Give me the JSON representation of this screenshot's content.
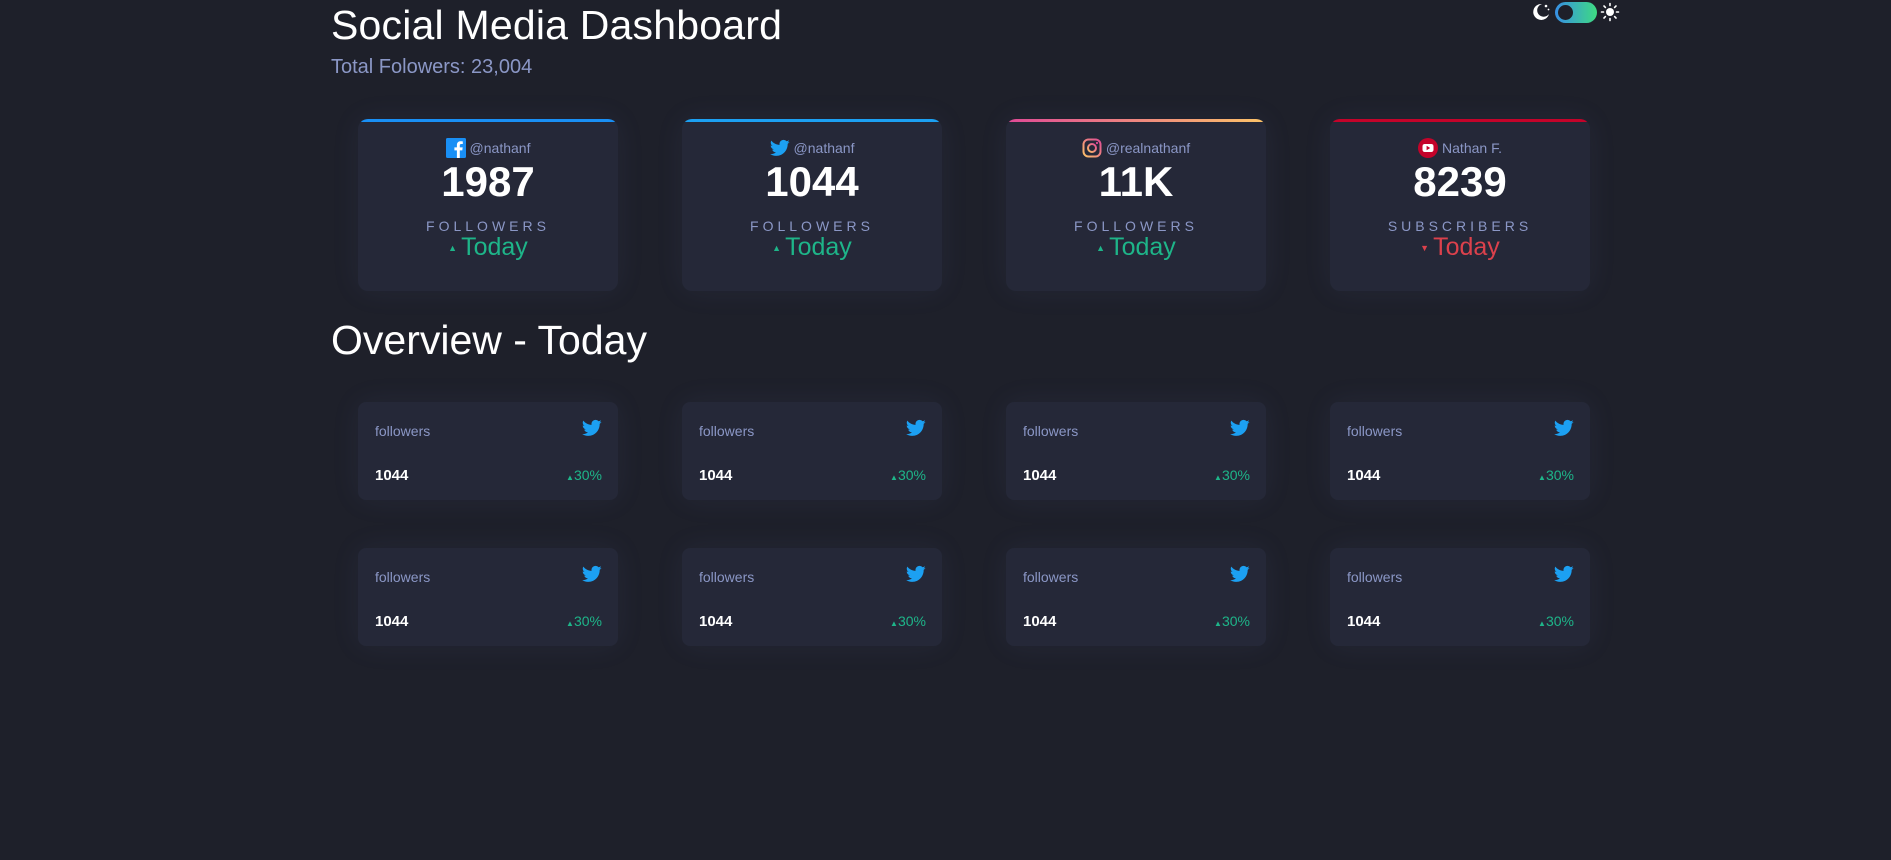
{
  "header": {
    "title": "Social Media Dashboard",
    "subtitle": "Total Folowers: 23,004"
  },
  "theme_toggle": {
    "mode": "dark",
    "moon_icon": "moon-icon",
    "sun_icon": "sun-icon"
  },
  "colors": {
    "background": "#1e202a",
    "card": "#252838",
    "text_muted": "#8b97c6",
    "up": "#1eb589",
    "down": "#dc414c",
    "facebook": "#198ff5",
    "twitter": "#1ca0f2",
    "youtube": "#c4032a"
  },
  "cards": [
    {
      "platform": "facebook",
      "icon": "facebook-icon",
      "handle": "@nathanf",
      "count": "1987",
      "label": "FOLLOWERS",
      "change": "Today",
      "trend": "up"
    },
    {
      "platform": "twitter",
      "icon": "twitter-icon",
      "handle": "@nathanf",
      "count": "1044",
      "label": "FOLLOWERS",
      "change": "Today",
      "trend": "up"
    },
    {
      "platform": "instagram",
      "icon": "instagram-icon",
      "handle": "@realnathanf",
      "count": "11K",
      "label": "FOLLOWERS",
      "change": "Today",
      "trend": "up"
    },
    {
      "platform": "youtube",
      "icon": "youtube-icon",
      "handle": "Nathan F.",
      "count": "8239",
      "label": "SUBSCRIBERS",
      "change": "Today",
      "trend": "down"
    }
  ],
  "overview": {
    "title": "Overview - Today",
    "items": [
      {
        "label": "followers",
        "icon": "twitter-icon",
        "value": "1044",
        "change": "30%",
        "trend": "up"
      },
      {
        "label": "followers",
        "icon": "twitter-icon",
        "value": "1044",
        "change": "30%",
        "trend": "up"
      },
      {
        "label": "followers",
        "icon": "twitter-icon",
        "value": "1044",
        "change": "30%",
        "trend": "up"
      },
      {
        "label": "followers",
        "icon": "twitter-icon",
        "value": "1044",
        "change": "30%",
        "trend": "up"
      },
      {
        "label": "followers",
        "icon": "twitter-icon",
        "value": "1044",
        "change": "30%",
        "trend": "up"
      },
      {
        "label": "followers",
        "icon": "twitter-icon",
        "value": "1044",
        "change": "30%",
        "trend": "up"
      },
      {
        "label": "followers",
        "icon": "twitter-icon",
        "value": "1044",
        "change": "30%",
        "trend": "up"
      },
      {
        "label": "followers",
        "icon": "twitter-icon",
        "value": "1044",
        "change": "30%",
        "trend": "up"
      }
    ]
  }
}
